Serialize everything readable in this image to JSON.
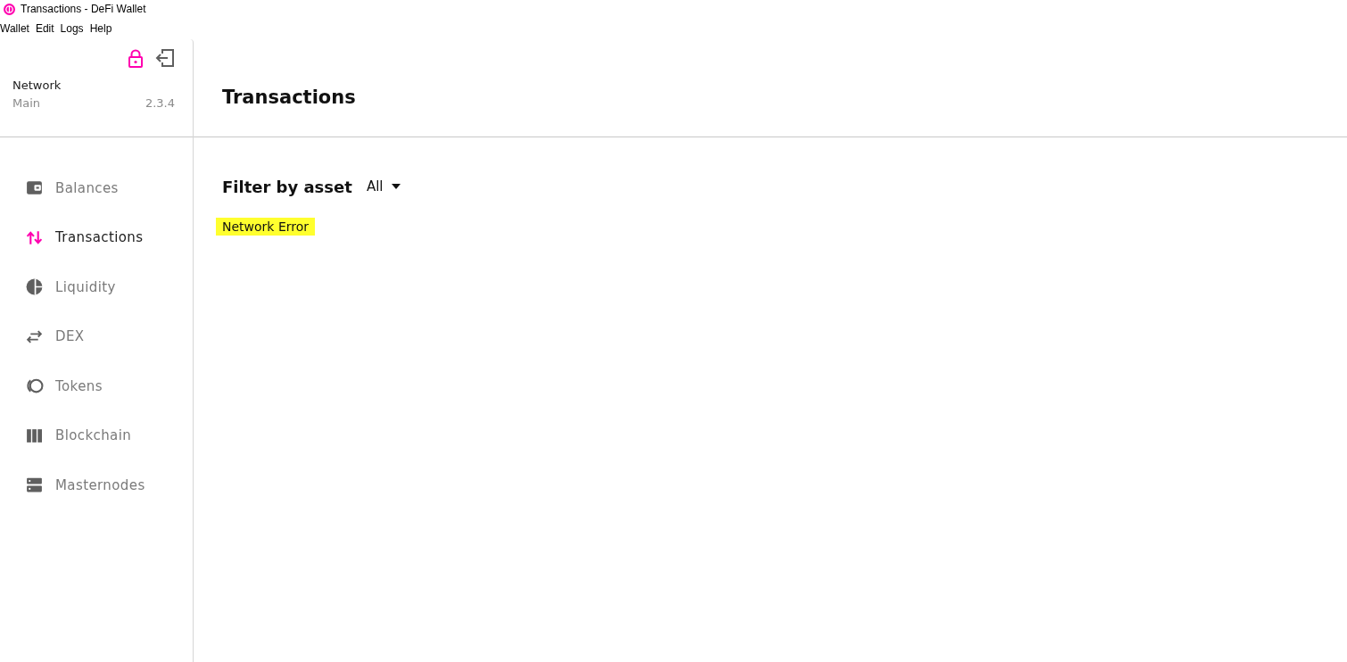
{
  "window": {
    "title": "Transactions - DeFi Wallet"
  },
  "menu_bar": [
    "Wallet",
    "Edit",
    "Logs",
    "Help"
  ],
  "sidebar": {
    "network": {
      "label": "Network",
      "name": "Main",
      "version": "2.3.4"
    },
    "items": [
      {
        "label": "Balances",
        "selected": false
      },
      {
        "label": "Transactions",
        "selected": true
      },
      {
        "label": "Liquidity",
        "selected": false
      },
      {
        "label": "DEX",
        "selected": false
      },
      {
        "label": "Tokens",
        "selected": false
      },
      {
        "label": "Blockchain",
        "selected": false
      },
      {
        "label": "Masternodes",
        "selected": false
      }
    ]
  },
  "main": {
    "title": "Transactions",
    "filter": {
      "label": "Filter by asset",
      "value": "All"
    },
    "error": {
      "text": "Network Error",
      "highlighted": true
    }
  }
}
